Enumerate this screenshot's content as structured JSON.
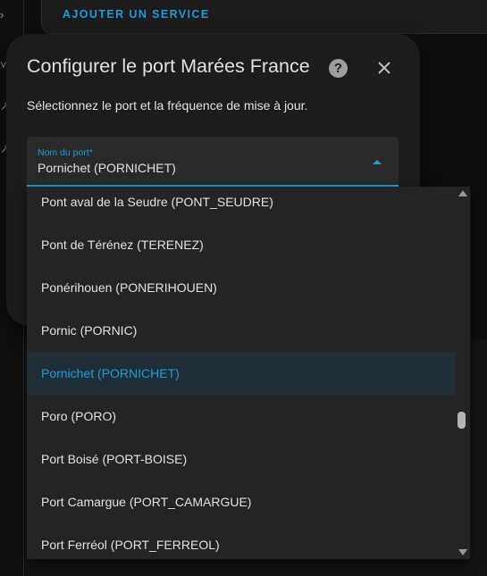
{
  "background": {
    "card_action": "AJOUTER UN SERVICE"
  },
  "dialog": {
    "title": "Configurer le port Marées France",
    "help_icon": "help-circle-icon",
    "close_icon": "close-icon",
    "description": "Sélectionnez le port et la fréquence de mise à jour.",
    "port_select": {
      "label": "Nom du port*",
      "value": "Pornichet (PORNICHET)"
    }
  },
  "dropdown": {
    "options": [
      "Pont aval de la Seudre (PONT_SEUDRE)",
      "Pont de Térénez (TERENEZ)",
      "Ponérihouen (PONERIHOUEN)",
      "Pornic (PORNIC)",
      "Pornichet (PORNICHET)",
      "Poro (PORO)",
      "Port Boisé (PORT-BOISE)",
      "Port Camargue (PORT_CAMARGUE)",
      "Port Ferréol (PORT_FERREOL)"
    ],
    "selected_index": 4
  },
  "colors": {
    "accent": "#1e9bdc",
    "dialog_bg": "#1c1c1c",
    "selected_bg": "#1f2e37"
  }
}
